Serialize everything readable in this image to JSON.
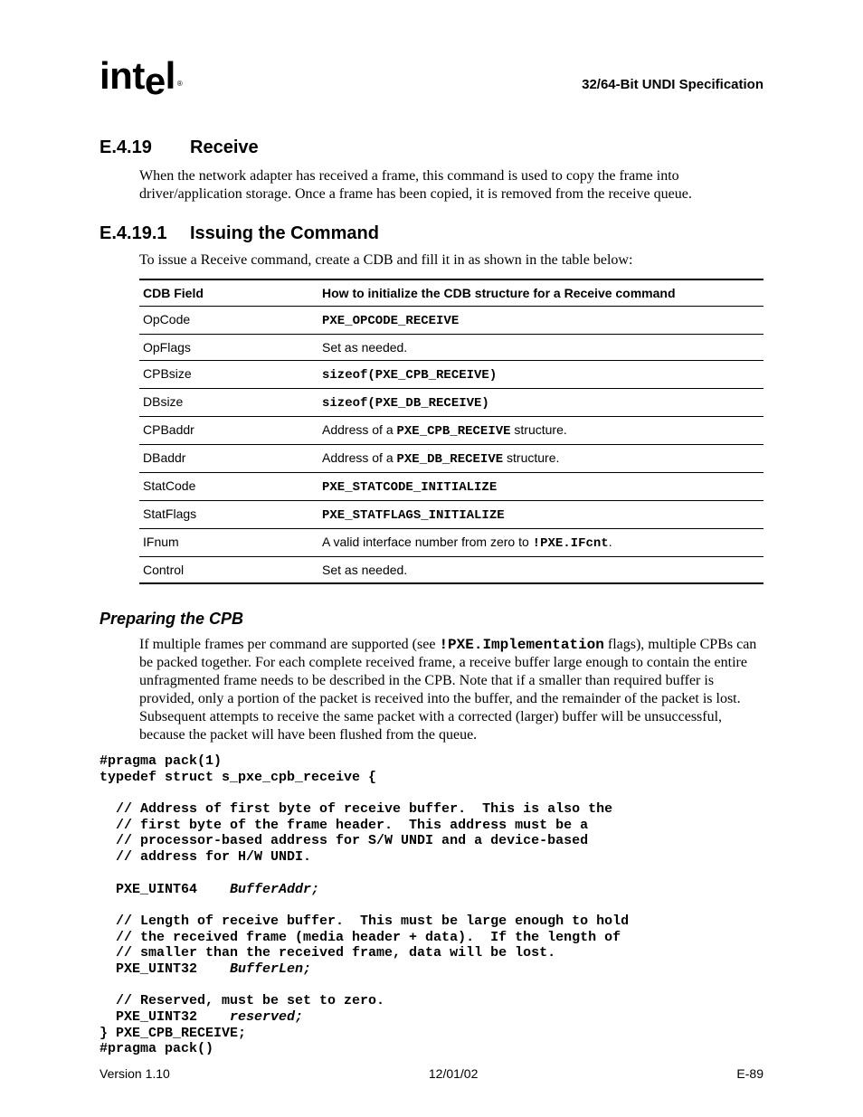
{
  "header": {
    "logo_text": "intel",
    "doc_title": "32/64-Bit UNDI Specification"
  },
  "sections": {
    "s1_num": "E.4.19",
    "s1_title": "Receive",
    "s1_para": "When the network adapter has received a frame, this command is used to copy the frame into driver/application storage.  Once a frame has been copied, it is removed from the receive queue.",
    "s2_num": "E.4.19.1",
    "s2_title": "Issuing the Command",
    "s2_para": "To issue a Receive command, create a CDB and fill it in as shown in the table below:",
    "s3_title": "Preparing the CPB",
    "s3_para_pre": "If multiple frames per command are supported (see ",
    "s3_para_code": "!PXE.Implementation",
    "s3_para_post": " flags), multiple CPBs can be packed together.  For each complete received frame, a receive buffer large enough to contain the entire unfragmented frame needs to be described in the CPB.  Note that if a smaller than required buffer is provided, only a portion of the packet is received into the buffer, and the remainder of the packet is lost.  Subsequent attempts to receive the same packet with a corrected (larger) buffer will be unsuccessful, because the packet will have been flushed from the queue."
  },
  "table": {
    "head_col1": "CDB Field",
    "head_col2": "How to initialize the CDB structure for a Receive command",
    "rows": [
      {
        "c1": "OpCode",
        "c2_mono": "PXE_OPCODE_RECEIVE"
      },
      {
        "c1": "OpFlags",
        "c2_plain": "Set as needed."
      },
      {
        "c1": "CPBsize",
        "c2_mono": "sizeof(PXE_CPB_RECEIVE)"
      },
      {
        "c1": "DBsize",
        "c2_mono": "sizeof(PXE_DB_RECEIVE)"
      },
      {
        "c1": "CPBaddr",
        "c2_pre": "Address of a ",
        "c2_mono": "PXE_CPB_RECEIVE",
        "c2_post": " structure."
      },
      {
        "c1": "DBaddr",
        "c2_pre": "Address of a ",
        "c2_mono": "PXE_DB_RECEIVE",
        "c2_post": " structure."
      },
      {
        "c1": "StatCode",
        "c2_mono": "PXE_STATCODE_INITIALIZE"
      },
      {
        "c1": "StatFlags",
        "c2_mono": "PXE_STATFLAGS_INITIALIZE"
      },
      {
        "c1": "IFnum",
        "c2_pre": "A valid interface number from zero to ",
        "c2_mono": "!PXE.IFcnt",
        "c2_post": "."
      },
      {
        "c1": "Control",
        "c2_plain": "Set as needed."
      }
    ]
  },
  "code": {
    "l1": "#pragma pack(1)",
    "l2": "typedef struct s_pxe_cpb_receive {",
    "l3": "",
    "l4": "  // Address of first byte of receive buffer.  This is also the",
    "l5": "  // first byte of the frame header.  This address must be a",
    "l6": "  // processor-based address for S/W UNDI and a device-based",
    "l7": "  // address for H/W UNDI.",
    "l8": "",
    "l9a": "  PXE_UINT64    ",
    "l9b": "BufferAddr;",
    "l10": "",
    "l11": "  // Length of receive buffer.  This must be large enough to hold",
    "l12": "  // the received frame (media header + data).  If the length of",
    "l13": "  // smaller than the received frame, data will be lost.",
    "l14a": "  PXE_UINT32    ",
    "l14b": "BufferLen;",
    "l15": "",
    "l16": "  // Reserved, must be set to zero.",
    "l17a": "  PXE_UINT32    ",
    "l17b": "reserved;",
    "l18": "} PXE_CPB_RECEIVE;",
    "l19": "#pragma pack()"
  },
  "footer": {
    "left": "Version 1.10",
    "center": "12/01/02",
    "right": "E-89"
  }
}
